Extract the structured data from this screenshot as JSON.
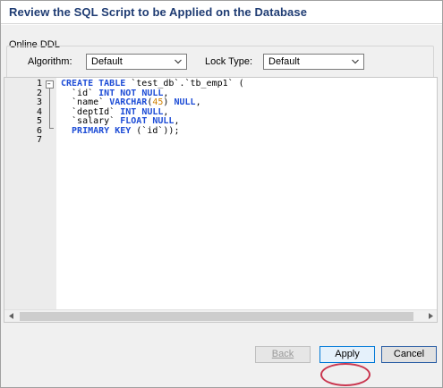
{
  "header": {
    "title": "Review the SQL Script to be Applied on the Database"
  },
  "online_ddl": {
    "legend": "Online DDL",
    "algorithm_label": "Algorithm:",
    "algorithm_value": "Default",
    "lock_type_label": "Lock Type:",
    "lock_type_value": "Default"
  },
  "editor": {
    "line_numbers": [
      "1",
      "2",
      "3",
      "4",
      "5",
      "6",
      "7"
    ],
    "code": {
      "l1_kw": "CREATE TABLE",
      "l1_rest": " `test_db`.`tb_emp1` (",
      "l2_ident": "  `id` ",
      "l2_kw": "INT NOT NULL",
      "l2_rest": ",",
      "l3_ident": "  `name` ",
      "l3_kw": "VARCHAR",
      "l3_open": "(",
      "l3_num": "45",
      "l3_close": ") ",
      "l3_kw2": "NULL",
      "l3_rest": ",",
      "l4_ident": "  `deptId` ",
      "l4_kw": "INT NULL",
      "l4_rest": ",",
      "l5_ident": "  `salary` ",
      "l5_kw": "FLOAT NULL",
      "l5_rest": ",",
      "l6_kw": "  PRIMARY KEY",
      "l6_rest": " (`id`));"
    }
  },
  "buttons": {
    "back": "Back",
    "apply": "Apply",
    "cancel": "Cancel"
  },
  "colors": {
    "title": "#1f3c73",
    "keyword": "#1e4dd6",
    "number": "#d08000",
    "highlight_circle": "#c9364f"
  }
}
